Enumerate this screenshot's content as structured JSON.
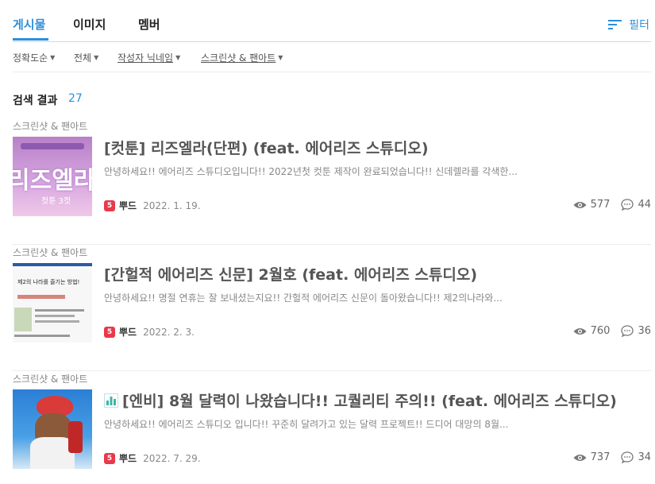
{
  "tabs": [
    {
      "label": "게시물",
      "active": true
    },
    {
      "label": "이미지",
      "active": false
    },
    {
      "label": "멤버",
      "active": false
    }
  ],
  "filter_label": "필터",
  "sort_options": [
    {
      "label": "정확도순",
      "underline": false
    },
    {
      "label": "전체",
      "underline": false
    },
    {
      "label": "작성자 닉네임",
      "underline": true
    },
    {
      "label": "스크린샷 & 팬아트",
      "underline": true
    }
  ],
  "results": {
    "label": "검색 결과",
    "count": "27"
  },
  "posts": [
    {
      "category": "스크린샷 & 팬아트",
      "title": "[컷툰] 리즈엘라(단편) (feat. 에어리즈 스튜디오)",
      "excerpt": "안녕하세요!! 에어리즈 스튜디오입니다!! 2022년첫 컷툰 제작이 완료되었습니다!! 신데렐라를 각색한...",
      "badge": "5",
      "author": "뿌드",
      "date": "2022. 1. 19.",
      "views": "577",
      "comments": "44",
      "thumb_text": "리즈엘라",
      "thumb_sub": "컷툰 3컷"
    },
    {
      "category": "스크린샷 & 팬아트",
      "title": "[간헐적 에어리즈 신문] 2월호 (feat. 에어리즈 스튜디오)",
      "excerpt": "안녕하세요!! 명절 연휴는 잘 보내셨는지요!! 간헐적 에어리즈 신문이 돌아왔습니다!! 제2의나라와...",
      "badge": "5",
      "author": "뿌드",
      "date": "2022. 2. 3.",
      "views": "760",
      "comments": "36",
      "thumb_text": "제2의 나라를 즐기는 방법!"
    },
    {
      "category": "스크린샷 & 팬아트",
      "title": "[엔비] 8월 달력이 나왔습니다!! 고퀄리티 주의!! (feat. 에어리즈 스튜디오)",
      "excerpt": "안녕하세요!! 에어리즈 스튜디오 입니다!! 꾸준히 달려가고 있는 달력 프로젝트!! 드디어 대망의 8월...",
      "badge": "5",
      "author": "뿌드",
      "date": "2022. 7. 29.",
      "views": "737",
      "comments": "34",
      "has_chart_icon": true
    }
  ],
  "colors": {
    "accent": "#2e8fd9",
    "badge": "#e8394b"
  },
  "icons": {
    "filter": "filter-lines-icon",
    "views": "eye-icon",
    "comments": "comment-bubble-icon",
    "chart": "bar-chart-icon"
  }
}
